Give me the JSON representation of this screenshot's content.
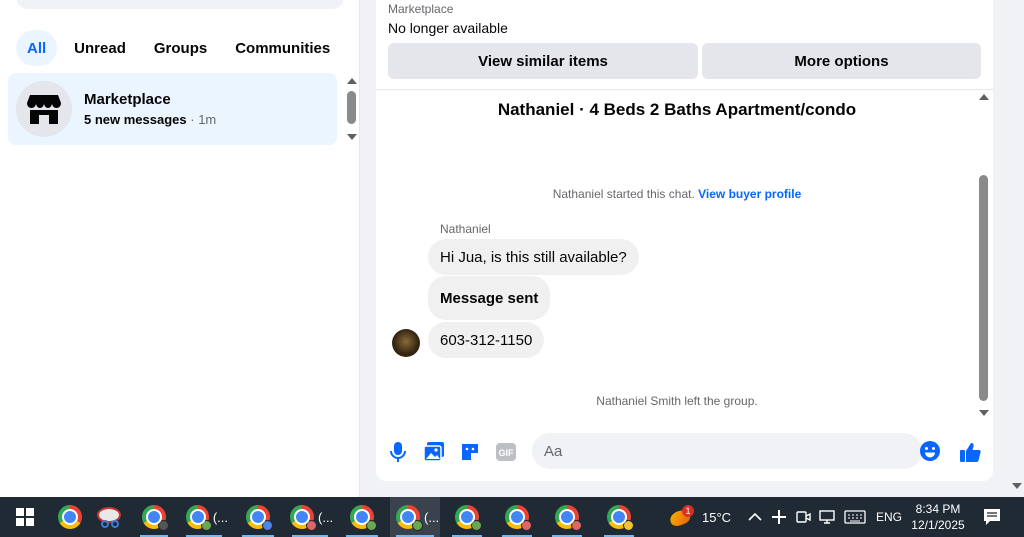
{
  "sidebar": {
    "filters": [
      "All",
      "Unread",
      "Groups",
      "Communities"
    ],
    "active_filter": "All",
    "conversation": {
      "name": "Marketplace",
      "unread": "5 new messages",
      "time": "· 1m"
    }
  },
  "listing": {
    "label": "Marketplace",
    "status": "No longer available",
    "view_similar": "View similar items",
    "more_options": "More options"
  },
  "chat": {
    "title": "Nathaniel · 4 Beds 2 Baths Apartment/condo",
    "started_text": "Nathaniel started this chat.",
    "buyer_profile_link": "View buyer profile",
    "sender_name": "Nathaniel",
    "messages": [
      "Hi Jua, is this still available?",
      "Message sent",
      "603-312-1150"
    ],
    "left_notice": "Nathaniel Smith left the group."
  },
  "composer": {
    "placeholder": "Aa"
  },
  "taskbar": {
    "ellipsis": "(...",
    "weather_badge": "1",
    "temperature": "15°C",
    "language": "ENG",
    "time": "8:34 PM",
    "date": "12/1/2025"
  },
  "colors": {
    "accent": "#0866ff",
    "highlight": "#ebf5ff",
    "taskbar": "#1f2a35"
  }
}
